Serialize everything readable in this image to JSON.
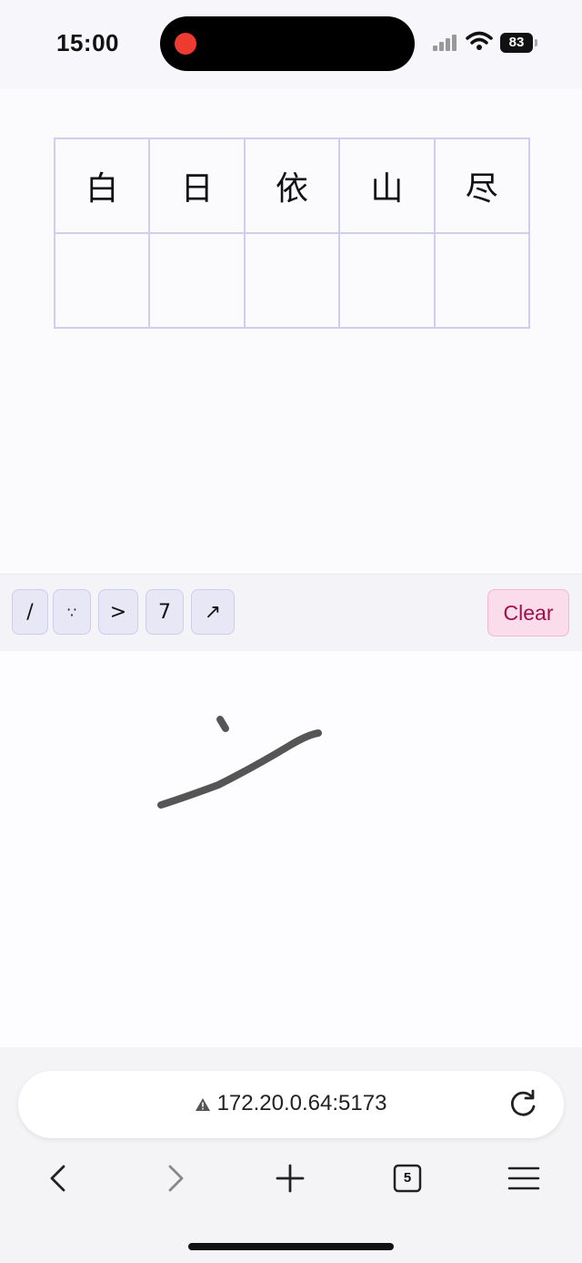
{
  "status_bar": {
    "time": "15:00",
    "battery": "83"
  },
  "grid": {
    "row1": [
      "白",
      "日",
      "依",
      "山",
      "尽"
    ],
    "row2": [
      "",
      "",
      "",
      "",
      ""
    ]
  },
  "toolbar": {
    "candidates": [
      "/",
      "∵",
      ">",
      "7",
      "↗"
    ],
    "clear_label": "Clear"
  },
  "browser": {
    "url": "172.20.0.64:5173",
    "tab_count": "5"
  },
  "colors": {
    "grid_line": "#cfcdf2",
    "candidate_bg": "#e7e7f6",
    "clear_bg": "#fadcea",
    "clear_text": "#a0104a",
    "stroke": "#555555",
    "record_dot": "#ee3b2f"
  }
}
